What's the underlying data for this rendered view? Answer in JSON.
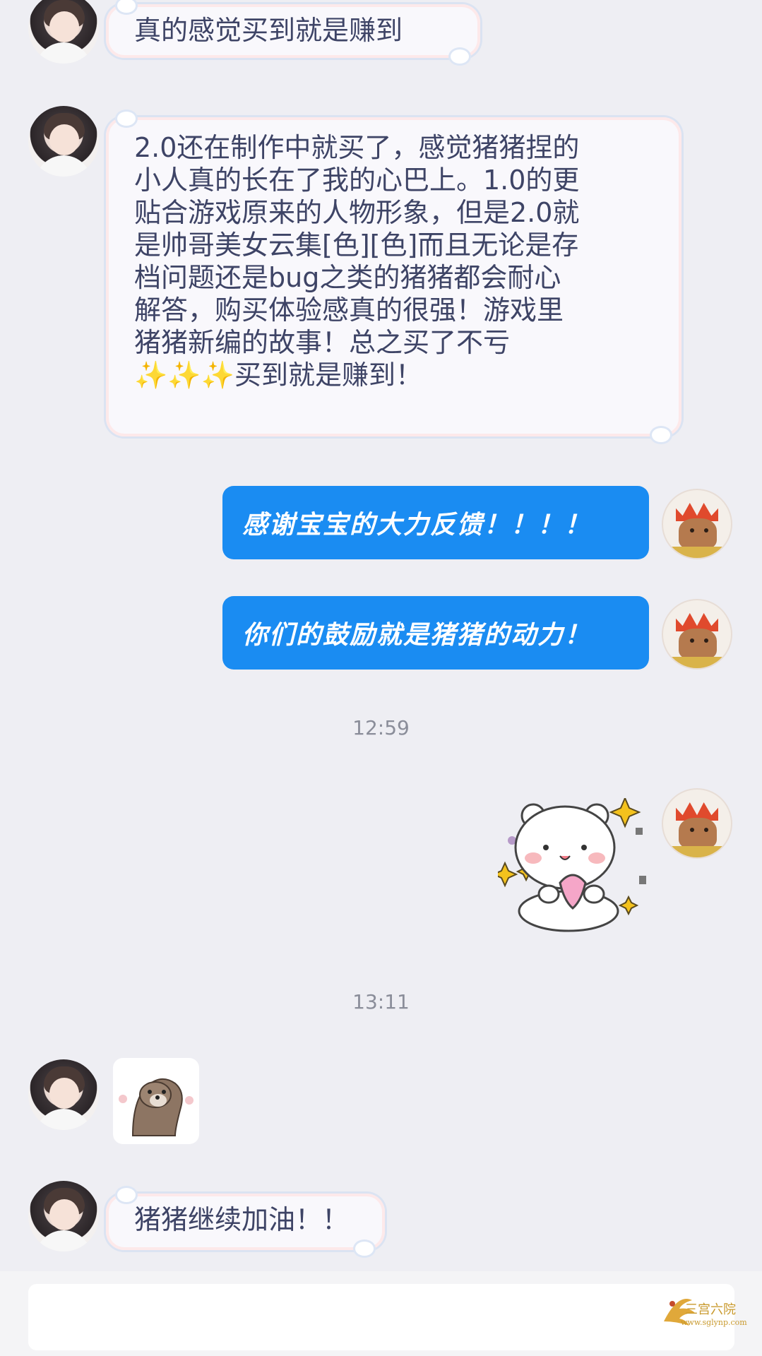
{
  "messages": {
    "m1": {
      "sender": "user",
      "text": "真的感觉买到就是赚到"
    },
    "m2": {
      "sender": "user",
      "lines": [
        "2.0还在制作中就买了，感觉猪猪捏的",
        "小人真的长在了我的心巴上。1.0的更",
        "贴合游戏原来的人物形象，但是2.0就",
        "是帅哥美女云集[色][色]而且无论是存",
        "档问题还是bug之类的猪猪都会耐心",
        "解答，购买体验感真的很强！游戏里",
        "猪猪新编的故事！总之买了不亏",
        "✨✨✨买到就是赚到！"
      ]
    },
    "m3": {
      "sender": "shop",
      "text": "感谢宝宝的大力反馈！！！！"
    },
    "m4": {
      "sender": "shop",
      "text": "你们的鼓励就是猪猪的动力！"
    },
    "m5": {
      "sender": "shop",
      "sticker": "white-bear-holding-heart"
    },
    "m6": {
      "sender": "user",
      "sticker": "otter"
    },
    "m7": {
      "sender": "user",
      "text": "猪猪继续加油！！"
    }
  },
  "timestamps": {
    "t1": "12:59",
    "t2": "13:11"
  },
  "colors": {
    "background": "#eeeef3",
    "shop_bubble": "#1a8cf2",
    "user_bubble": "#f9f8fc"
  },
  "watermark": {
    "line1": "三宫六院",
    "line2": "www.sglynp.com"
  }
}
